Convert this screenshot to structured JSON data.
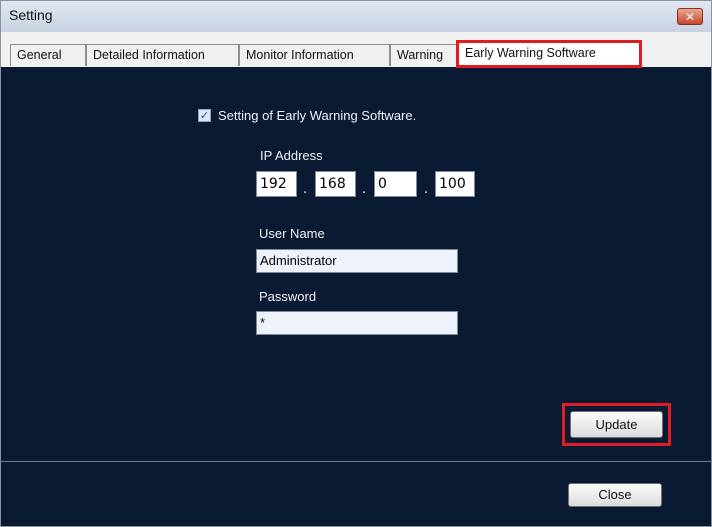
{
  "window": {
    "title": "Setting",
    "close_glyph": "✕"
  },
  "tabs": [
    {
      "label": "General"
    },
    {
      "label": "Detailed Information"
    },
    {
      "label": "Monitor Information"
    },
    {
      "label": "Warning"
    },
    {
      "label": "Early Warning Software",
      "active": true
    }
  ],
  "form": {
    "checkbox_label": "Setting of Early Warning Software.",
    "checkbox_checked": true,
    "check_glyph": "✓",
    "ip_label": "IP Address",
    "ip_octets": [
      "192",
      "168",
      "0",
      "100"
    ],
    "ip_separator": ".",
    "username_label": "User Name",
    "username_value": "Administrator",
    "password_label": "Password",
    "password_value": "*"
  },
  "buttons": {
    "update": "Update",
    "close": "Close"
  },
  "colors": {
    "highlight": "#e21b23",
    "panel_bg": "#0b1a33"
  }
}
